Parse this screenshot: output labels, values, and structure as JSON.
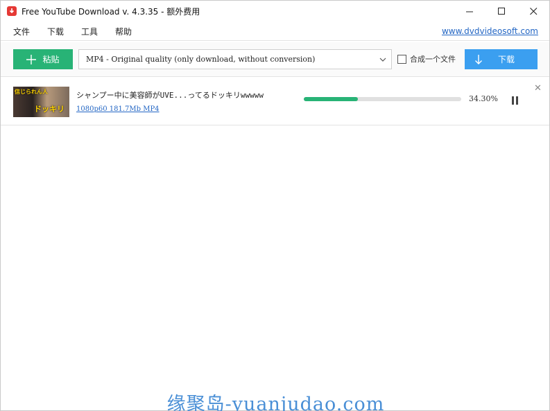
{
  "window": {
    "title": "Free YouTube Download v. 4.3.35 - 额外费用"
  },
  "menu": {
    "items": [
      "文件",
      "下载",
      "工具",
      "帮助"
    ],
    "site_link": "www.dvdvideosoft.com"
  },
  "toolbar": {
    "paste_label": "粘贴",
    "format_value": "MP4 - Original quality (only download, without conversion)",
    "merge_label": "合成一个文件",
    "merge_checked": false,
    "download_label": "下载"
  },
  "download_item": {
    "title": "シャンプー中に美容師がUVE...ってるドッキリwwwww",
    "meta": "1080p60 181.7Mb MP4 ",
    "progress": 0.343,
    "percent_text": "34.30%",
    "thumb_caption_top": "信じられん人",
    "thumb_caption_bottom": "ドッキリ"
  },
  "watermark": "缘聚岛-yuanjudao.com",
  "colors": {
    "paste_green": "#28b376",
    "download_blue": "#3b9ff0",
    "link_blue": "#2366c4",
    "app_icon_red": "#e53935"
  },
  "icons": [
    "download-app-icon",
    "minimize-icon",
    "maximize-icon",
    "close-icon",
    "plus-icon",
    "chevron-down-icon",
    "arrow-down-icon",
    "pause-icon",
    "remove-icon"
  ]
}
